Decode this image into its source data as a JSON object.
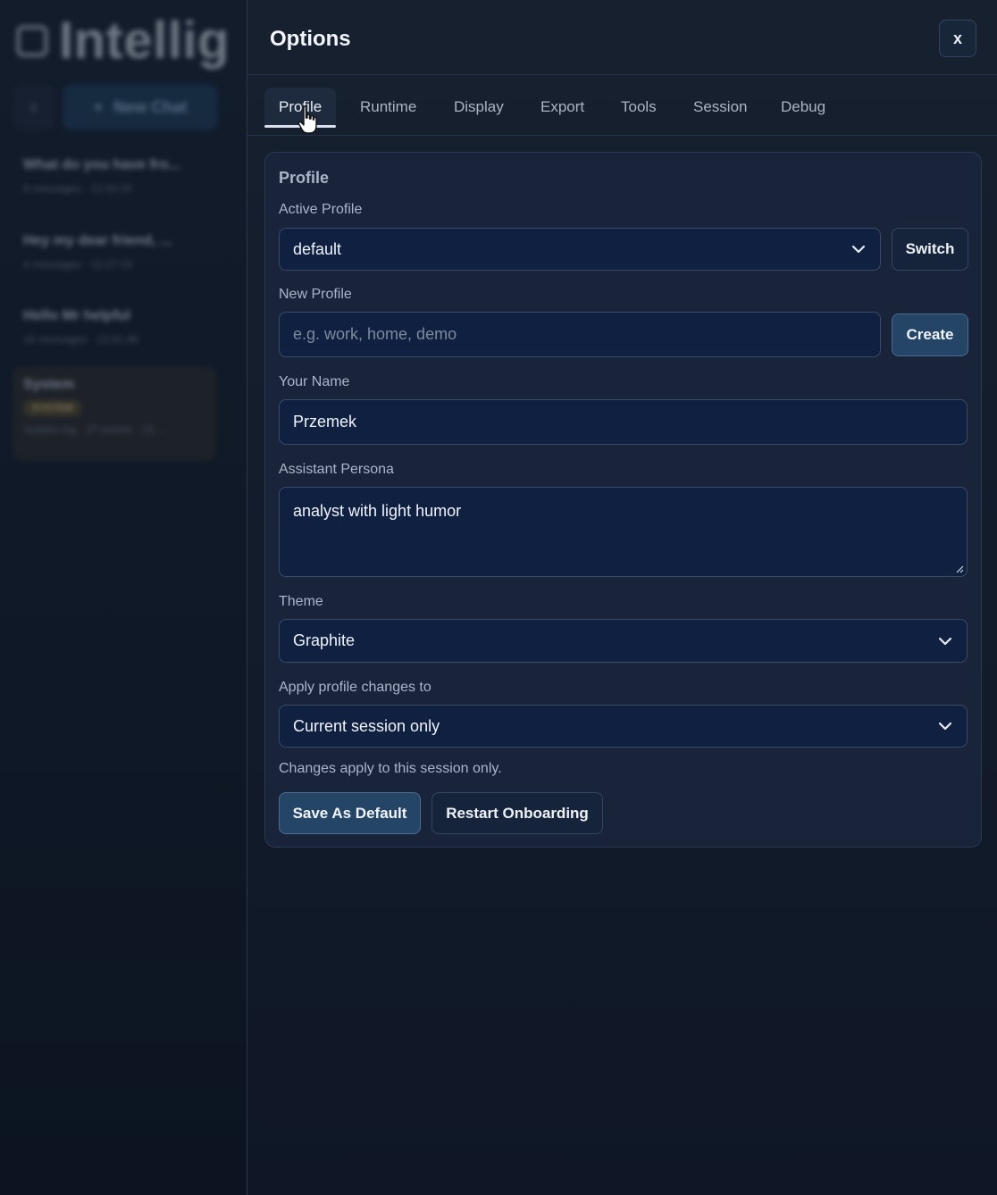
{
  "background": {
    "logo_text": "Intellig",
    "new_chat_label": "New Chat",
    "back_glyph": "‹",
    "chats": [
      {
        "title": "What do you have fro...",
        "meta": "6 messages · 12:42:32"
      },
      {
        "title": "Hey my dear friend, ...",
        "meta": "4 messages · 12:27:23"
      },
      {
        "title": "Hello Mr helpful",
        "meta": "16 messages · 12:01:46"
      }
    ],
    "system_chat": {
      "title": "System",
      "badge": "SYSTEM",
      "meta": "System log · 37 events · 12:..."
    }
  },
  "dialog": {
    "title": "Options",
    "close_label": "x",
    "tabs": [
      "Profile",
      "Runtime",
      "Display",
      "Export",
      "Tools",
      "Session",
      "Debug"
    ],
    "active_tab": "Profile"
  },
  "profile": {
    "section_title": "Profile",
    "active_profile_label": "Active Profile",
    "active_profile_value": "default",
    "switch_label": "Switch",
    "new_profile_label": "New Profile",
    "new_profile_placeholder": "e.g. work, home, demo",
    "create_label": "Create",
    "your_name_label": "Your Name",
    "your_name_value": "Przemek",
    "persona_label": "Assistant Persona",
    "persona_value": "analyst with light humor",
    "theme_label": "Theme",
    "theme_value": "Graphite",
    "apply_label": "Apply profile changes to",
    "apply_value": "Current session only",
    "apply_hint": "Changes apply to this session only.",
    "save_default_label": "Save As Default",
    "restart_onboarding_label": "Restart Onboarding"
  },
  "icons": {
    "chevron": "chevron-down-icon",
    "cursor": "pointer-cursor-icon",
    "resize": "resize-grip-icon"
  }
}
